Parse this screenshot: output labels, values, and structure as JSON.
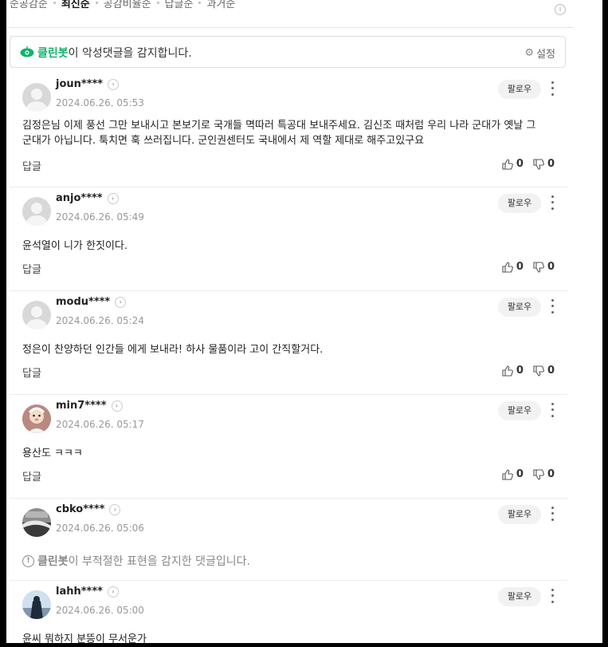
{
  "sort": {
    "tabs": [
      "순공감순",
      "최신순",
      "공감비율순",
      "답글순",
      "과거순"
    ],
    "active_index": 1
  },
  "cleanbot": {
    "brand": "클린봇",
    "message": "이 악성댓글을 감지합니다.",
    "settings_label": "설정"
  },
  "labels": {
    "follow": "팔로우",
    "reply": "답글"
  },
  "comments": [
    {
      "nickname": "joun****",
      "date": "2024.06.26. 05:53",
      "text": "김정은님 이제 풍선 그만 보내시고 본보기로 국개들 멱따러 특공대 보내주세요. 김신조 때처럼 우리 나라 군대가 옛날 그 군대가 아닙니다. 툭치면 훅 쓰러집니다. 군인권센터도 국내에서 제 역할 제대로 해주고있구요",
      "likes": "0",
      "dislikes": "0"
    },
    {
      "nickname": "anjo****",
      "date": "2024.06.26. 05:49",
      "text": "윤석열이 니가 한짓이다.",
      "likes": "0",
      "dislikes": "0"
    },
    {
      "nickname": "modu****",
      "date": "2024.06.26. 05:24",
      "text": "정은이 찬양하던 인간들 에게 보내라! 하사 물품이라 고이 간직할거다.",
      "likes": "0",
      "dislikes": "0"
    },
    {
      "nickname": "min7****",
      "date": "2024.06.26. 05:17",
      "text": "용산도 ㅋㅋㅋ",
      "likes": "0",
      "dislikes": "0"
    },
    {
      "nickname": "cbko****",
      "date": "2024.06.26. 05:06",
      "flag_brand": "클린봇",
      "flag_message": "이 부적절한 표현을 감지한 댓글입니다."
    },
    {
      "nickname": "lahh****",
      "date": "2024.06.26. 05:00",
      "text": "윤씨 뭐하지 분뜽이 무서운가"
    }
  ],
  "colors": {
    "brand_green": "#11b36b"
  },
  "icons": [
    "eye-bot-icon",
    "gear-icon",
    "info-icon",
    "chevron-right-icon",
    "more-vertical-icon",
    "thumbs-up-icon",
    "thumbs-down-icon",
    "exclamation-circle-icon",
    "avatar-icon"
  ]
}
